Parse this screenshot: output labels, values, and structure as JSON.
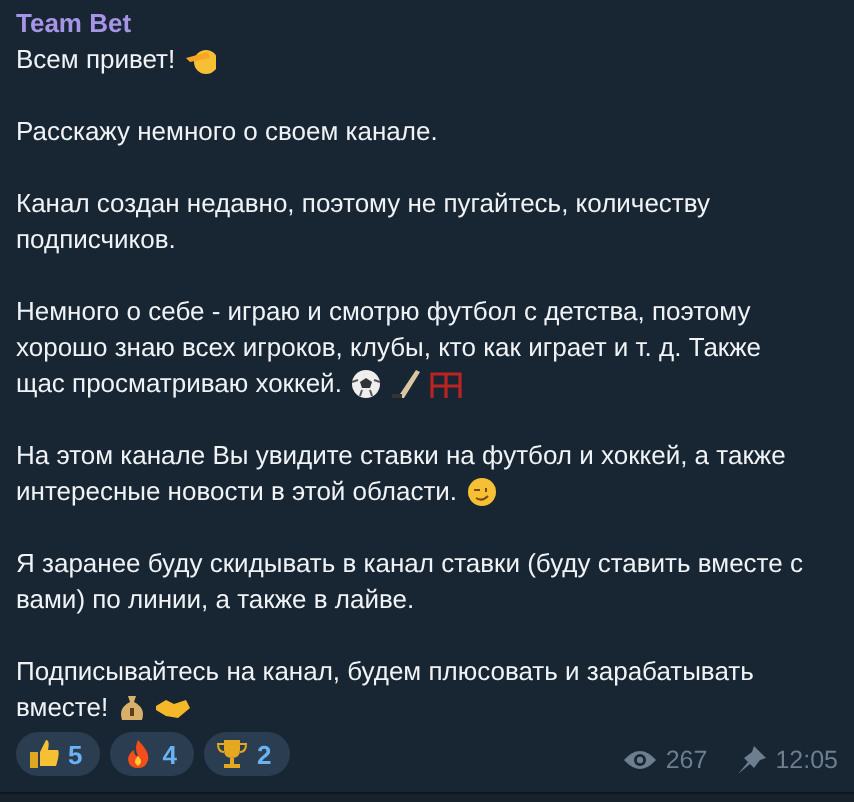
{
  "message": {
    "author": "Team Bet",
    "paragraphs": [
      "Всем привет!",
      "Расскажу немного о своем канале.",
      "Канал создан недавно, поэтому не пугайтесь, количеству\nподписчиков.",
      "Немного о себе - играю и смотрю футбол с детства, поэтому\nхорошо знаю всех игроков, клубы, кто как играет и т. д. Также\nщас просматриваю хоккей.",
      "На этом канале Вы увидите ставки на футбол и хоккей, а также\nинтересные новости в этой области.",
      "Я заранее буду скидывать в канал ставки (буду ставить вместе с\nвами) по линии, а также в лайве.",
      "Подписывайтесь на канал, будем плюсовать и зарабатывать\nвместе!"
    ],
    "reactions": [
      {
        "count": "5"
      },
      {
        "count": "4"
      },
      {
        "count": "2"
      }
    ],
    "views": "267",
    "time": "12:05"
  }
}
